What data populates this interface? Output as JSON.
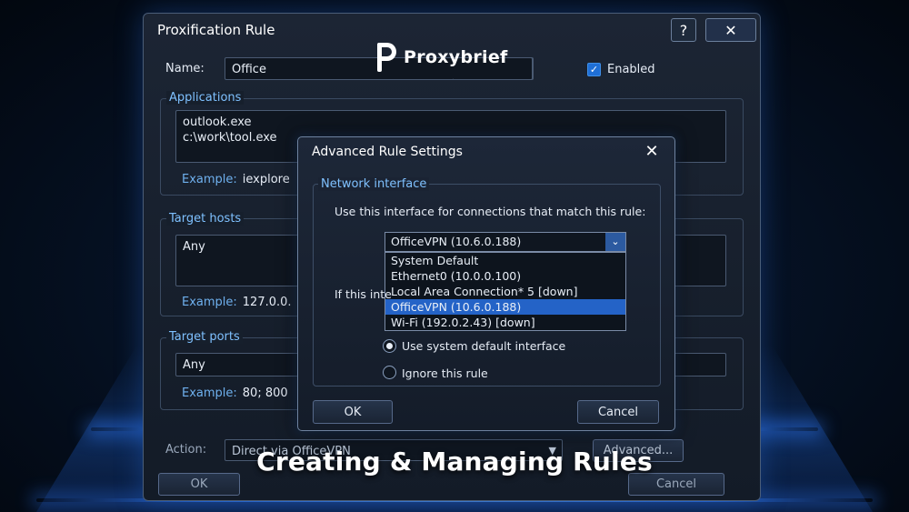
{
  "main_window": {
    "title": "Proxification Rule",
    "help_glyph": "?",
    "close_glyph": "✕",
    "name_label": "Name:",
    "name_value": "Office",
    "enabled_label": "Enabled",
    "enabled_checked": true,
    "applications": {
      "title": "Applications",
      "lines": [
        "outlook.exe",
        "c:\\work\\tool.exe"
      ],
      "example_label": "Example:",
      "example_value": "iexplore"
    },
    "target_hosts": {
      "title": "Target hosts",
      "value": "Any",
      "example_label": "Example:",
      "example_value": "127.0.0."
    },
    "target_ports": {
      "title": "Target ports",
      "value": "Any",
      "example_label": "Example:",
      "example_value": "80; 800"
    },
    "action_label": "Action:",
    "action_value": "Direct via OfficeVPN",
    "advanced_button": "Advanced...",
    "ok_button": "OK",
    "cancel_button": "Cancel"
  },
  "logo": {
    "text": "Proxybrief"
  },
  "dialog": {
    "title": "Advanced Rule Settings",
    "close_glyph": "✕",
    "group_title": "Network interface",
    "instruction": "Use this interface for connections that match this rule:",
    "selected": "OfficeVPN (10.6.0.188)",
    "options": [
      "System Default",
      "Ethernet0 (10.0.0.100)",
      "Local Area Connection* 5 [down]",
      "OfficeVPN (10.6.0.188)",
      "Wi-Fi (192.0.2.43)  [down]"
    ],
    "selected_index": 3,
    "fallback_label_partial": "If this inte",
    "radio_1": "Use system default interface",
    "radio_2": "Ignore this rule",
    "radio_selected": 1,
    "ok_button": "OK",
    "cancel_button": "Cancel"
  },
  "caption": "Creating & Managing Rules",
  "colors": {
    "accent": "#2463c7",
    "section_title": "#7fc1ff",
    "example_text": "#6fb1ef"
  }
}
